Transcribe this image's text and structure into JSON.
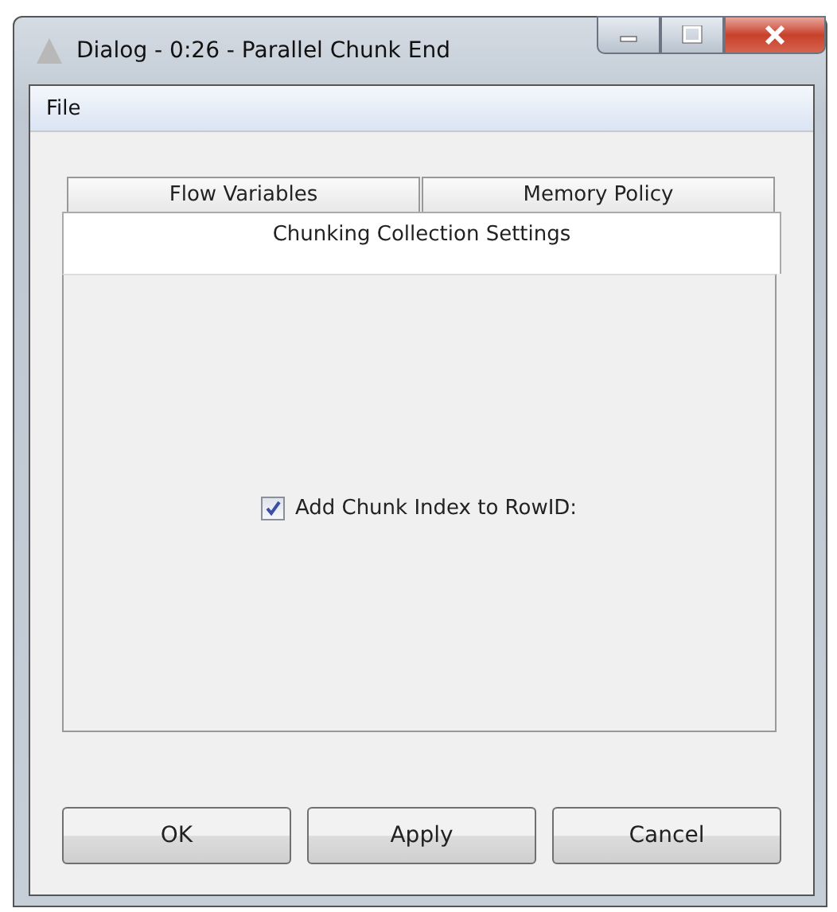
{
  "window": {
    "title": "Dialog - 0:26 - Parallel Chunk End"
  },
  "menu_bar": [
    "File"
  ],
  "tab_rows": [
    {
      "tabs": [
        {
          "label": "Flow Variables",
          "selected": false
        },
        {
          "label": "Memory Policy",
          "selected": false
        }
      ]
    },
    {
      "tabs": [
        {
          "label": "Chunking Collection Settings",
          "selected": true
        }
      ]
    }
  ],
  "option": {
    "label": "Add Chunk Index to RowID:",
    "checked": true
  },
  "buttons": [
    "OK",
    "Apply",
    "Cancel"
  ]
}
